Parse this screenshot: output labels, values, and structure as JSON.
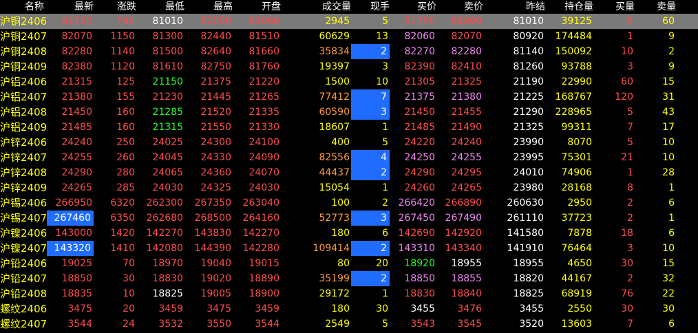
{
  "colors": {
    "background": "#000000",
    "header_text": "#ffffff",
    "name": "#ffff00",
    "up": "#ff4d4d",
    "down": "#22ff22",
    "neutral": "#ffffff",
    "volume": "#ffff00",
    "volume_dim": "#ff9a3a",
    "bid_ask": "#ee88ee",
    "highlight_bg": "#1f6cff",
    "selected_row_bg": "#7a7a7a"
  },
  "table": {
    "headers": [
      "名称",
      "最新",
      "涨跌",
      "最低",
      "最高",
      "开盘",
      "成交量",
      "现手",
      "买价",
      "卖价",
      "昨结",
      "持仓量",
      "买量",
      "卖量"
    ],
    "rows": [
      {
        "cells": [
          "沪铜2406",
          "81750",
          "740",
          "81010",
          "82090",
          "81060",
          "2945",
          "5",
          "81750",
          "81800",
          "81010",
          "39125",
          "5",
          "60"
        ],
        "colors": [
          "name",
          "up",
          "up",
          "neutral",
          "up",
          "up",
          "volume",
          "volume",
          "up",
          "up",
          "neutral",
          "volume",
          "up",
          "volume"
        ],
        "highlight": [],
        "selected": true
      },
      {
        "cells": [
          "沪铜2407",
          "82070",
          "1150",
          "81300",
          "82440",
          "81510",
          "60629",
          "13",
          "82060",
          "82070",
          "80920",
          "174484",
          "1",
          "9"
        ],
        "colors": [
          "name",
          "up",
          "up",
          "up",
          "up",
          "up",
          "volume",
          "volume",
          "bid_ask",
          "up",
          "neutral",
          "volume",
          "up",
          "volume"
        ],
        "highlight": [],
        "selected": false
      },
      {
        "cells": [
          "沪铜2408",
          "82280",
          "1140",
          "81500",
          "82640",
          "81660",
          "35834",
          "2",
          "82270",
          "82280",
          "81140",
          "150092",
          "10",
          "2"
        ],
        "colors": [
          "name",
          "up",
          "up",
          "up",
          "up",
          "up",
          "volume_dim",
          "neutral",
          "bid_ask",
          "bid_ask",
          "neutral",
          "volume",
          "up",
          "volume"
        ],
        "highlight": [
          7
        ],
        "selected": false
      },
      {
        "cells": [
          "沪铜2409",
          "82380",
          "1120",
          "81610",
          "82750",
          "81760",
          "19397",
          "3",
          "82390",
          "82410",
          "81260",
          "93788",
          "3",
          "9"
        ],
        "colors": [
          "name",
          "up",
          "up",
          "up",
          "up",
          "up",
          "volume",
          "volume",
          "up",
          "up",
          "neutral",
          "volume",
          "up",
          "volume"
        ],
        "highlight": [],
        "selected": false
      },
      {
        "cells": [
          "沪铝2406",
          "21315",
          "125",
          "21150",
          "21375",
          "21220",
          "1500",
          "10",
          "21305",
          "21325",
          "21190",
          "22990",
          "60",
          "15"
        ],
        "colors": [
          "name",
          "up",
          "up",
          "down",
          "up",
          "up",
          "volume",
          "volume",
          "up",
          "up",
          "neutral",
          "volume",
          "up",
          "volume"
        ],
        "highlight": [],
        "selected": false
      },
      {
        "cells": [
          "沪铝2407",
          "21380",
          "155",
          "21230",
          "21445",
          "21265",
          "77412",
          "7",
          "21375",
          "21380",
          "21225",
          "168767",
          "120",
          "31"
        ],
        "colors": [
          "name",
          "up",
          "up",
          "up",
          "up",
          "up",
          "volume_dim",
          "neutral",
          "bid_ask",
          "bid_ask",
          "neutral",
          "volume",
          "up",
          "volume"
        ],
        "highlight": [
          7
        ],
        "selected": false
      },
      {
        "cells": [
          "沪铝2408",
          "21450",
          "160",
          "21285",
          "21520",
          "21335",
          "60590",
          "3",
          "21450",
          "21455",
          "21290",
          "228965",
          "5",
          "43"
        ],
        "colors": [
          "name",
          "up",
          "up",
          "down",
          "up",
          "up",
          "volume_dim",
          "neutral",
          "up",
          "up",
          "neutral",
          "volume",
          "up",
          "volume"
        ],
        "highlight": [
          7
        ],
        "selected": false
      },
      {
        "cells": [
          "沪铝2409",
          "21485",
          "160",
          "21315",
          "21550",
          "21330",
          "18607",
          "1",
          "21485",
          "21490",
          "21325",
          "99311",
          "7",
          "17"
        ],
        "colors": [
          "name",
          "up",
          "up",
          "down",
          "up",
          "up",
          "volume",
          "volume",
          "up",
          "up",
          "neutral",
          "volume",
          "up",
          "volume"
        ],
        "highlight": [],
        "selected": false
      },
      {
        "cells": [
          "沪锌2406",
          "24240",
          "250",
          "24025",
          "24300",
          "24100",
          "400",
          "5",
          "24220",
          "24240",
          "23990",
          "8070",
          "5",
          "10"
        ],
        "colors": [
          "name",
          "up",
          "up",
          "up",
          "up",
          "up",
          "volume",
          "volume",
          "up",
          "up",
          "neutral",
          "volume",
          "up",
          "volume"
        ],
        "highlight": [],
        "selected": false
      },
      {
        "cells": [
          "沪锌2407",
          "24255",
          "260",
          "24045",
          "24330",
          "24090",
          "82556",
          "4",
          "24250",
          "24255",
          "23995",
          "75301",
          "21",
          "10"
        ],
        "colors": [
          "name",
          "up",
          "up",
          "up",
          "up",
          "up",
          "volume_dim",
          "neutral",
          "bid_ask",
          "bid_ask",
          "neutral",
          "volume",
          "up",
          "volume"
        ],
        "highlight": [
          7
        ],
        "selected": false
      },
      {
        "cells": [
          "沪锌2408",
          "24290",
          "280",
          "24065",
          "24360",
          "24070",
          "44437",
          "2",
          "24290",
          "24295",
          "24010",
          "74906",
          "1",
          "28"
        ],
        "colors": [
          "name",
          "up",
          "up",
          "up",
          "up",
          "up",
          "volume_dim",
          "neutral",
          "up",
          "up",
          "neutral",
          "volume",
          "up",
          "volume"
        ],
        "highlight": [
          7
        ],
        "selected": false
      },
      {
        "cells": [
          "沪锌2409",
          "24265",
          "285",
          "24030",
          "24325",
          "24030",
          "15054",
          "1",
          "24260",
          "24265",
          "23980",
          "28168",
          "8",
          "1"
        ],
        "colors": [
          "name",
          "up",
          "up",
          "up",
          "up",
          "up",
          "volume",
          "volume",
          "up",
          "up",
          "neutral",
          "volume",
          "up",
          "volume"
        ],
        "highlight": [],
        "selected": false
      },
      {
        "cells": [
          "沪锡2406",
          "266950",
          "6320",
          "262300",
          "267350",
          "263040",
          "100",
          "2",
          "266420",
          "266890",
          "260630",
          "2950",
          "2",
          "6"
        ],
        "colors": [
          "name",
          "up",
          "up",
          "up",
          "up",
          "up",
          "volume",
          "volume",
          "bid_ask",
          "up",
          "neutral",
          "volume",
          "up",
          "volume"
        ],
        "highlight": [],
        "selected": false
      },
      {
        "cells": [
          "沪锡2407",
          "267460",
          "6350",
          "262680",
          "268500",
          "264160",
          "52773",
          "3",
          "267450",
          "267490",
          "261110",
          "37723",
          "2",
          "1"
        ],
        "colors": [
          "name",
          "neutral",
          "up",
          "up",
          "up",
          "up",
          "volume_dim",
          "neutral",
          "bid_ask",
          "bid_ask",
          "neutral",
          "volume",
          "up",
          "volume"
        ],
        "highlight": [
          1,
          7
        ],
        "selected": false
      },
      {
        "cells": [
          "沪镍2406",
          "143000",
          "1420",
          "142270",
          "143830",
          "142270",
          "180",
          "6",
          "142690",
          "142920",
          "141580",
          "7878",
          "18",
          "6"
        ],
        "colors": [
          "name",
          "up",
          "up",
          "up",
          "up",
          "up",
          "volume",
          "volume",
          "up",
          "up",
          "neutral",
          "volume",
          "up",
          "volume"
        ],
        "highlight": [],
        "selected": false
      },
      {
        "cells": [
          "沪镍2407",
          "143320",
          "1410",
          "142080",
          "144390",
          "142280",
          "109414",
          "2",
          "143310",
          "143340",
          "141910",
          "76464",
          "3",
          "10"
        ],
        "colors": [
          "name",
          "neutral",
          "up",
          "up",
          "up",
          "up",
          "volume_dim",
          "neutral",
          "bid_ask",
          "up",
          "neutral",
          "volume",
          "up",
          "volume"
        ],
        "highlight": [
          1,
          7
        ],
        "selected": false
      },
      {
        "cells": [
          "沪铅2406",
          "19025",
          "70",
          "18970",
          "19040",
          "19015",
          "80",
          "20",
          "18920",
          "18955",
          "18955",
          "4650",
          "30",
          "15"
        ],
        "colors": [
          "name",
          "up",
          "up",
          "up",
          "up",
          "up",
          "volume",
          "volume",
          "down",
          "neutral",
          "neutral",
          "volume",
          "up",
          "volume"
        ],
        "highlight": [],
        "selected": false
      },
      {
        "cells": [
          "沪铅2407",
          "18850",
          "30",
          "18830",
          "19020",
          "18890",
          "35199",
          "2",
          "18850",
          "18855",
          "18820",
          "44167",
          "2",
          "32"
        ],
        "colors": [
          "name",
          "up",
          "up",
          "up",
          "up",
          "up",
          "volume_dim",
          "neutral",
          "bid_ask",
          "bid_ask",
          "neutral",
          "volume",
          "up",
          "volume"
        ],
        "highlight": [
          7
        ],
        "selected": false
      },
      {
        "cells": [
          "沪铅2408",
          "18835",
          "10",
          "18825",
          "19005",
          "18900",
          "29172",
          "1",
          "18830",
          "18840",
          "18825",
          "68919",
          "76",
          "22"
        ],
        "colors": [
          "name",
          "up",
          "up",
          "neutral",
          "up",
          "up",
          "volume",
          "volume",
          "up",
          "up",
          "neutral",
          "volume",
          "up",
          "volume"
        ],
        "highlight": [],
        "selected": false
      },
      {
        "cells": [
          "螺纹2406",
          "3475",
          "20",
          "3459",
          "3475",
          "3459",
          "180",
          "30",
          "3455",
          "3476",
          "3455",
          "2550",
          "30",
          "30"
        ],
        "colors": [
          "name",
          "up",
          "up",
          "up",
          "up",
          "up",
          "volume",
          "volume",
          "neutral",
          "up",
          "neutral",
          "volume",
          "up",
          "volume"
        ],
        "highlight": [],
        "selected": false
      },
      {
        "cells": [
          "螺纹2407",
          "3544",
          "24",
          "3532",
          "3550",
          "3544",
          "2549",
          "5",
          "3543",
          "3545",
          "3520",
          "13603",
          "7",
          "6"
        ],
        "colors": [
          "name",
          "up",
          "up",
          "up",
          "up",
          "up",
          "volume",
          "volume",
          "up",
          "up",
          "neutral",
          "volume",
          "up",
          "volume"
        ],
        "highlight": [],
        "selected": false
      }
    ]
  }
}
